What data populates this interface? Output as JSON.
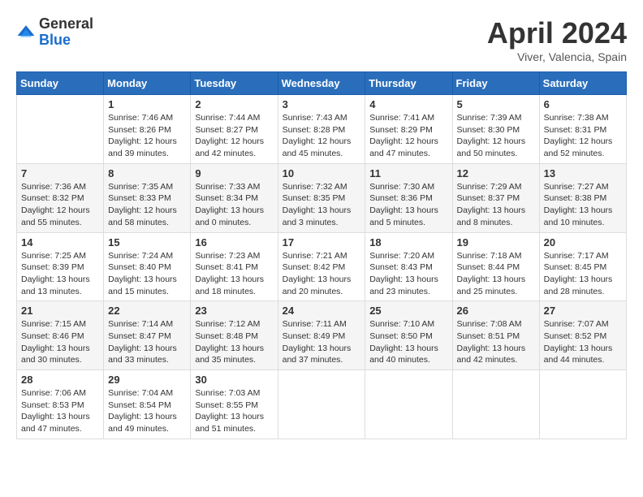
{
  "header": {
    "logo_general": "General",
    "logo_blue": "Blue",
    "month_title": "April 2024",
    "location": "Viver, Valencia, Spain"
  },
  "weekdays": [
    "Sunday",
    "Monday",
    "Tuesday",
    "Wednesday",
    "Thursday",
    "Friday",
    "Saturday"
  ],
  "weeks": [
    [
      {
        "day": "",
        "sunrise": "",
        "sunset": "",
        "daylight": ""
      },
      {
        "day": "1",
        "sunrise": "Sunrise: 7:46 AM",
        "sunset": "Sunset: 8:26 PM",
        "daylight": "Daylight: 12 hours and 39 minutes."
      },
      {
        "day": "2",
        "sunrise": "Sunrise: 7:44 AM",
        "sunset": "Sunset: 8:27 PM",
        "daylight": "Daylight: 12 hours and 42 minutes."
      },
      {
        "day": "3",
        "sunrise": "Sunrise: 7:43 AM",
        "sunset": "Sunset: 8:28 PM",
        "daylight": "Daylight: 12 hours and 45 minutes."
      },
      {
        "day": "4",
        "sunrise": "Sunrise: 7:41 AM",
        "sunset": "Sunset: 8:29 PM",
        "daylight": "Daylight: 12 hours and 47 minutes."
      },
      {
        "day": "5",
        "sunrise": "Sunrise: 7:39 AM",
        "sunset": "Sunset: 8:30 PM",
        "daylight": "Daylight: 12 hours and 50 minutes."
      },
      {
        "day": "6",
        "sunrise": "Sunrise: 7:38 AM",
        "sunset": "Sunset: 8:31 PM",
        "daylight": "Daylight: 12 hours and 52 minutes."
      }
    ],
    [
      {
        "day": "7",
        "sunrise": "Sunrise: 7:36 AM",
        "sunset": "Sunset: 8:32 PM",
        "daylight": "Daylight: 12 hours and 55 minutes."
      },
      {
        "day": "8",
        "sunrise": "Sunrise: 7:35 AM",
        "sunset": "Sunset: 8:33 PM",
        "daylight": "Daylight: 12 hours and 58 minutes."
      },
      {
        "day": "9",
        "sunrise": "Sunrise: 7:33 AM",
        "sunset": "Sunset: 8:34 PM",
        "daylight": "Daylight: 13 hours and 0 minutes."
      },
      {
        "day": "10",
        "sunrise": "Sunrise: 7:32 AM",
        "sunset": "Sunset: 8:35 PM",
        "daylight": "Daylight: 13 hours and 3 minutes."
      },
      {
        "day": "11",
        "sunrise": "Sunrise: 7:30 AM",
        "sunset": "Sunset: 8:36 PM",
        "daylight": "Daylight: 13 hours and 5 minutes."
      },
      {
        "day": "12",
        "sunrise": "Sunrise: 7:29 AM",
        "sunset": "Sunset: 8:37 PM",
        "daylight": "Daylight: 13 hours and 8 minutes."
      },
      {
        "day": "13",
        "sunrise": "Sunrise: 7:27 AM",
        "sunset": "Sunset: 8:38 PM",
        "daylight": "Daylight: 13 hours and 10 minutes."
      }
    ],
    [
      {
        "day": "14",
        "sunrise": "Sunrise: 7:25 AM",
        "sunset": "Sunset: 8:39 PM",
        "daylight": "Daylight: 13 hours and 13 minutes."
      },
      {
        "day": "15",
        "sunrise": "Sunrise: 7:24 AM",
        "sunset": "Sunset: 8:40 PM",
        "daylight": "Daylight: 13 hours and 15 minutes."
      },
      {
        "day": "16",
        "sunrise": "Sunrise: 7:23 AM",
        "sunset": "Sunset: 8:41 PM",
        "daylight": "Daylight: 13 hours and 18 minutes."
      },
      {
        "day": "17",
        "sunrise": "Sunrise: 7:21 AM",
        "sunset": "Sunset: 8:42 PM",
        "daylight": "Daylight: 13 hours and 20 minutes."
      },
      {
        "day": "18",
        "sunrise": "Sunrise: 7:20 AM",
        "sunset": "Sunset: 8:43 PM",
        "daylight": "Daylight: 13 hours and 23 minutes."
      },
      {
        "day": "19",
        "sunrise": "Sunrise: 7:18 AM",
        "sunset": "Sunset: 8:44 PM",
        "daylight": "Daylight: 13 hours and 25 minutes."
      },
      {
        "day": "20",
        "sunrise": "Sunrise: 7:17 AM",
        "sunset": "Sunset: 8:45 PM",
        "daylight": "Daylight: 13 hours and 28 minutes."
      }
    ],
    [
      {
        "day": "21",
        "sunrise": "Sunrise: 7:15 AM",
        "sunset": "Sunset: 8:46 PM",
        "daylight": "Daylight: 13 hours and 30 minutes."
      },
      {
        "day": "22",
        "sunrise": "Sunrise: 7:14 AM",
        "sunset": "Sunset: 8:47 PM",
        "daylight": "Daylight: 13 hours and 33 minutes."
      },
      {
        "day": "23",
        "sunrise": "Sunrise: 7:12 AM",
        "sunset": "Sunset: 8:48 PM",
        "daylight": "Daylight: 13 hours and 35 minutes."
      },
      {
        "day": "24",
        "sunrise": "Sunrise: 7:11 AM",
        "sunset": "Sunset: 8:49 PM",
        "daylight": "Daylight: 13 hours and 37 minutes."
      },
      {
        "day": "25",
        "sunrise": "Sunrise: 7:10 AM",
        "sunset": "Sunset: 8:50 PM",
        "daylight": "Daylight: 13 hours and 40 minutes."
      },
      {
        "day": "26",
        "sunrise": "Sunrise: 7:08 AM",
        "sunset": "Sunset: 8:51 PM",
        "daylight": "Daylight: 13 hours and 42 minutes."
      },
      {
        "day": "27",
        "sunrise": "Sunrise: 7:07 AM",
        "sunset": "Sunset: 8:52 PM",
        "daylight": "Daylight: 13 hours and 44 minutes."
      }
    ],
    [
      {
        "day": "28",
        "sunrise": "Sunrise: 7:06 AM",
        "sunset": "Sunset: 8:53 PM",
        "daylight": "Daylight: 13 hours and 47 minutes."
      },
      {
        "day": "29",
        "sunrise": "Sunrise: 7:04 AM",
        "sunset": "Sunset: 8:54 PM",
        "daylight": "Daylight: 13 hours and 49 minutes."
      },
      {
        "day": "30",
        "sunrise": "Sunrise: 7:03 AM",
        "sunset": "Sunset: 8:55 PM",
        "daylight": "Daylight: 13 hours and 51 minutes."
      },
      {
        "day": "",
        "sunrise": "",
        "sunset": "",
        "daylight": ""
      },
      {
        "day": "",
        "sunrise": "",
        "sunset": "",
        "daylight": ""
      },
      {
        "day": "",
        "sunrise": "",
        "sunset": "",
        "daylight": ""
      },
      {
        "day": "",
        "sunrise": "",
        "sunset": "",
        "daylight": ""
      }
    ]
  ]
}
